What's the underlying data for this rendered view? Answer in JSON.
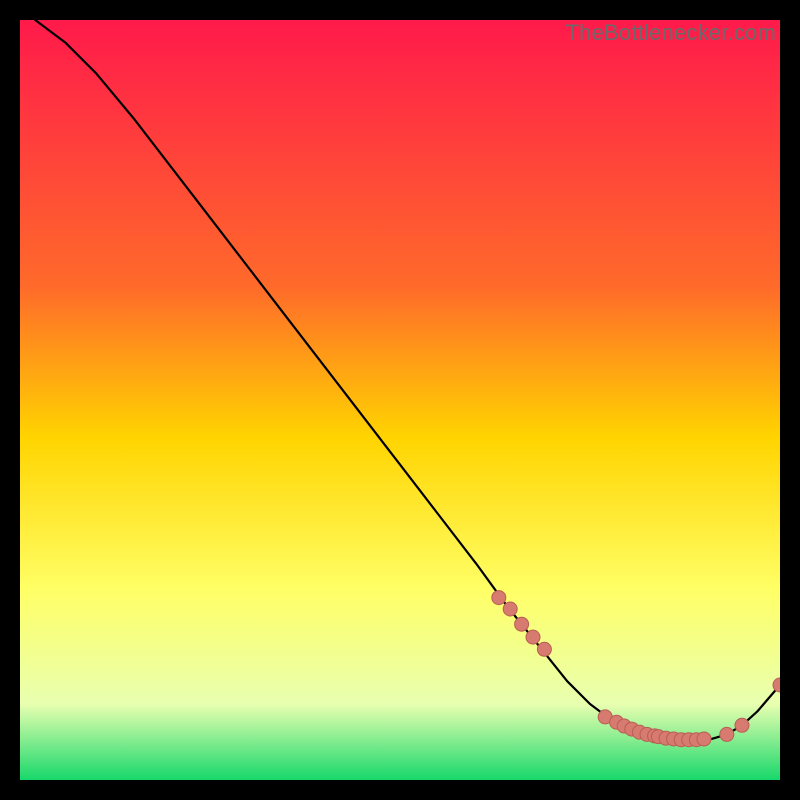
{
  "watermark": "TheBottlenecker.com",
  "colors": {
    "grad_top": "#ff1a4b",
    "grad_mid1": "#ff6a2a",
    "grad_mid2": "#ffd400",
    "grad_mid3": "#ffff66",
    "grad_mid4": "#e8ffb0",
    "grad_bot": "#17d86b",
    "curve": "#000000",
    "marker_fill": "#d77a6f",
    "marker_stroke": "#b95e53",
    "frame_bg": "#000000"
  },
  "chart_data": {
    "type": "line",
    "title": "",
    "xlabel": "",
    "ylabel": "",
    "xlim": [
      0,
      100
    ],
    "ylim": [
      0,
      100
    ],
    "x": [
      2,
      6,
      10,
      15,
      20,
      25,
      30,
      35,
      40,
      45,
      50,
      55,
      60,
      64,
      68,
      72,
      75,
      77,
      79,
      81,
      83,
      85,
      87,
      89,
      91,
      93,
      95,
      97,
      100
    ],
    "values": [
      100,
      97,
      93,
      87,
      80.5,
      74,
      67.5,
      61,
      54.5,
      48,
      41.5,
      35,
      28.5,
      23,
      18,
      13,
      10,
      8.5,
      7.3,
      6.4,
      5.8,
      5.4,
      5.2,
      5.2,
      5.4,
      6.0,
      7.2,
      9.0,
      12.5
    ],
    "markers_x": [
      63,
      64.5,
      66,
      67.5,
      69,
      77,
      78.5,
      79.5,
      80.5,
      81.5,
      82.5,
      83.5,
      84,
      85,
      86,
      87,
      88,
      89,
      90,
      93,
      95,
      100
    ],
    "markers_y": [
      24,
      22.5,
      20.5,
      18.8,
      17.2,
      8.3,
      7.6,
      7.1,
      6.7,
      6.3,
      6.0,
      5.8,
      5.7,
      5.5,
      5.4,
      5.3,
      5.3,
      5.3,
      5.4,
      6.0,
      7.2,
      12.5
    ]
  }
}
